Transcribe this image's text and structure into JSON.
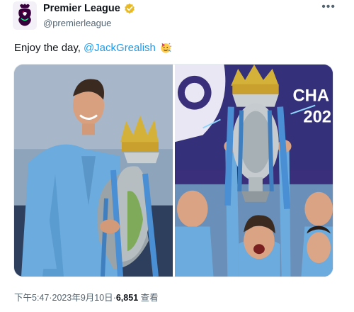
{
  "author": {
    "name": "Premier League",
    "handle": "@premierleague",
    "avatar_icon": "premier-league-lion-logo",
    "verified_icon": "verified-badge-icon",
    "verified_color": "#e8b923"
  },
  "menu_icon": "more-options-icon",
  "tweet": {
    "text": "Enjoy the day,",
    "mention": "@JackGrealish",
    "emoji": "party-face-emoji"
  },
  "media": {
    "photo_left": "player-kissing-trophy-photo",
    "photo_right": "player-lifting-trophy-photo",
    "banner_text_1": "CHA",
    "banner_text_2": "202"
  },
  "meta": {
    "time": "下午5:47",
    "separator": "·",
    "date": "2023年9月10日",
    "views": "6,851",
    "views_label": "查看"
  },
  "colors": {
    "link": "#1d9bf0",
    "text": "#0f1419",
    "secondary": "#536471",
    "brand_purple": "#37003c"
  }
}
